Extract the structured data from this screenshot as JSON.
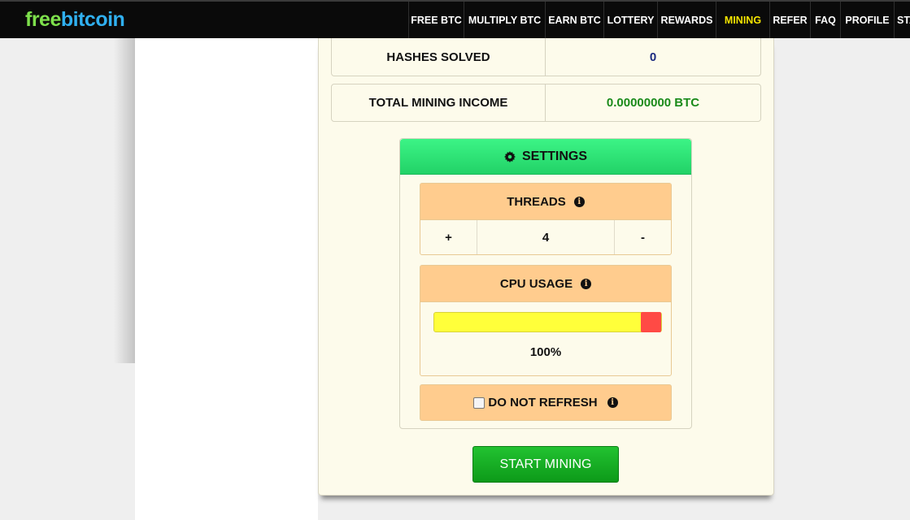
{
  "logo": {
    "part1": "free",
    "part2": "bitcoin"
  },
  "nav": [
    {
      "label": "FREE BTC",
      "active": false
    },
    {
      "label": "MULTIPLY BTC",
      "active": false
    },
    {
      "label": "EARN BTC",
      "active": false
    },
    {
      "label": "LOTTERY",
      "active": false
    },
    {
      "label": "REWARDS",
      "active": false
    },
    {
      "label": "MINING",
      "active": true
    },
    {
      "label": "REFER",
      "active": false
    },
    {
      "label": "FAQ",
      "active": false
    },
    {
      "label": "PROFILE",
      "active": false
    },
    {
      "label": "STA",
      "active": false
    }
  ],
  "stats": {
    "hashes_label": "HASHES SOLVED",
    "hashes_value": "0",
    "income_label": "TOTAL MINING INCOME",
    "income_value": "0.00000000 BTC"
  },
  "settings": {
    "title": "SETTINGS",
    "threads_label": "THREADS",
    "plus": "+",
    "threads_value": "4",
    "minus": "-",
    "cpu_label": "CPU USAGE",
    "cpu_percent_text": "100%",
    "cpu_level": 1.0,
    "no_refresh_label": "DO NOT REFRESH",
    "info_glyph": "i"
  },
  "start_button": "START MINING",
  "colors": {
    "accent_green": "#22d267",
    "active_nav": "#f7e600",
    "hashes_value": "#1a2a80",
    "income_value": "#1a8a1a"
  }
}
